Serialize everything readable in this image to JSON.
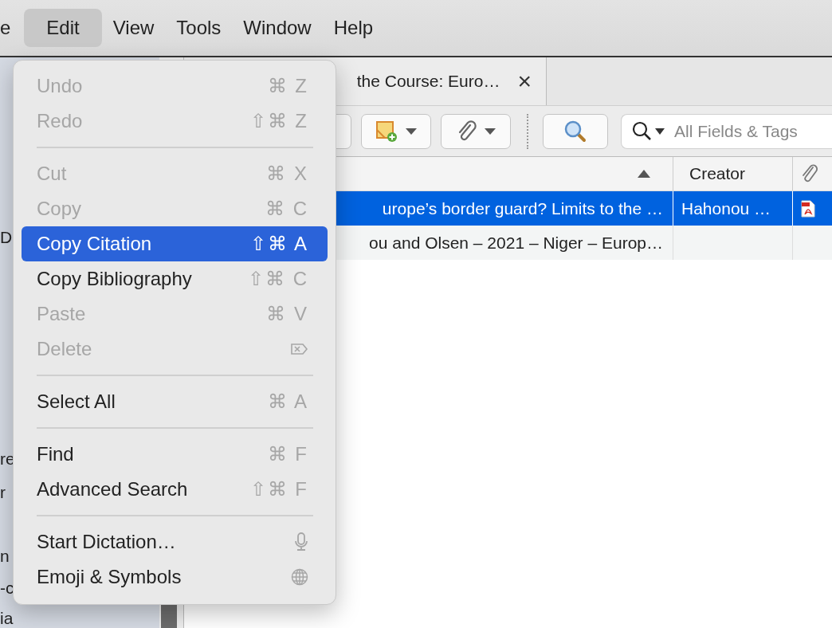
{
  "menubar": [
    {
      "label": "e",
      "selected": false
    },
    {
      "label": "Edit",
      "selected": true
    },
    {
      "label": "View",
      "selected": false
    },
    {
      "label": "Tools",
      "selected": false
    },
    {
      "label": "Window",
      "selected": false
    },
    {
      "label": "Help",
      "selected": false
    }
  ],
  "sidebar": {
    "items": [
      "D",
      "re",
      "r",
      "n",
      "-c",
      "ia"
    ]
  },
  "tab": {
    "title": "the Course: Euro…",
    "close": "×"
  },
  "search": {
    "placeholder": "All Fields & Tags"
  },
  "table": {
    "columns": [
      {
        "sorted": true
      },
      {
        "label": "Creator",
        "sorted": false
      },
      {
        "kind": "attachment",
        "sorted": false
      }
    ],
    "rows": [
      {
        "title": "urope’s border guard? Limits to the …",
        "creator": "Hahonou …",
        "pdf": true,
        "selected": true
      },
      {
        "title": "ou and Olsen – 2021 – Niger – Europ…",
        "creator": "",
        "pdf": false,
        "selected": false
      }
    ]
  },
  "edit_menu": [
    {
      "kind": "item",
      "label": "Undo",
      "shortcut": "⌘ Z",
      "disabled": true,
      "selected": false
    },
    {
      "kind": "item",
      "label": "Redo",
      "shortcut": "⇧⌘ Z",
      "disabled": true,
      "selected": false
    },
    {
      "kind": "separator"
    },
    {
      "kind": "item",
      "label": "Cut",
      "shortcut": "⌘ X",
      "disabled": true,
      "selected": false
    },
    {
      "kind": "item",
      "label": "Copy",
      "shortcut": "⌘ C",
      "disabled": true,
      "selected": false
    },
    {
      "kind": "item",
      "label": "Copy Citation",
      "shortcut": "⇧⌘ A",
      "disabled": false,
      "selected": true
    },
    {
      "kind": "item",
      "label": "Copy Bibliography",
      "shortcut": "⇧⌘ C",
      "disabled": false,
      "selected": false
    },
    {
      "kind": "item",
      "label": "Paste",
      "shortcut": "⌘ V",
      "disabled": true,
      "selected": false
    },
    {
      "kind": "icon_item",
      "label": "Delete",
      "disabled": true,
      "selected": false
    },
    {
      "kind": "separator"
    },
    {
      "kind": "item",
      "label": "Select All",
      "shortcut": "⌘ A",
      "disabled": false,
      "selected": false
    },
    {
      "kind": "separator"
    },
    {
      "kind": "item",
      "label": "Find",
      "shortcut": "⌘ F",
      "disabled": false,
      "selected": false
    },
    {
      "kind": "item",
      "label": "Advanced Search",
      "shortcut": "⇧⌘ F",
      "disabled": false,
      "selected": false
    },
    {
      "kind": "separator"
    },
    {
      "kind": "icon_item",
      "label": "Start Dictation…",
      "disabled": false,
      "selected": false
    },
    {
      "kind": "icon_item",
      "label": "Emoji & Symbols",
      "disabled": false,
      "selected": false
    }
  ]
}
